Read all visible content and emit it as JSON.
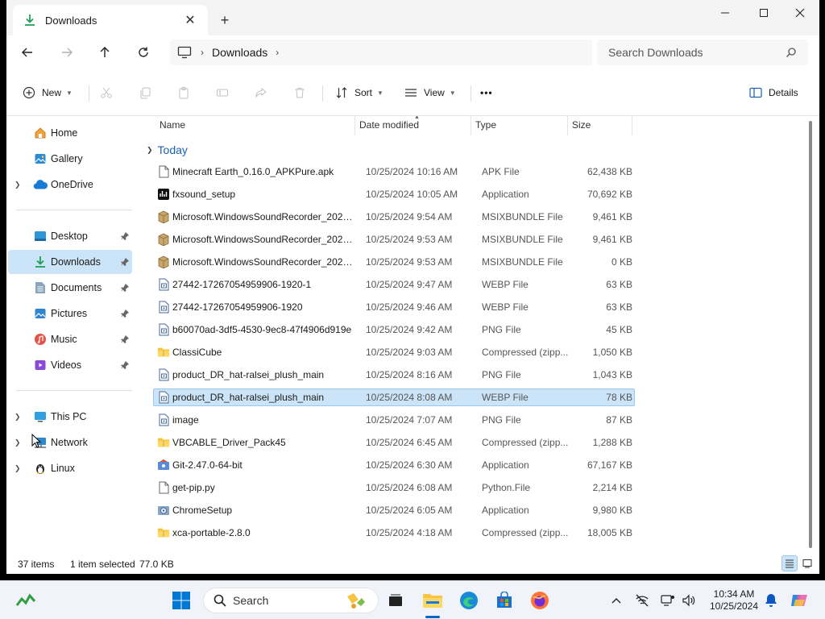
{
  "window": {
    "tab_title": "Downloads",
    "new_tab_symbol": "+",
    "close_symbol": "✕"
  },
  "address": {
    "crumbs": [
      "Downloads"
    ],
    "search_placeholder": "Search Downloads"
  },
  "commandbar": {
    "new_label": "New",
    "sort_label": "Sort",
    "view_label": "View",
    "more_label": "•••",
    "details_label": "Details"
  },
  "sidebar": {
    "items": [
      {
        "label": "Home",
        "icon": "home-icon"
      },
      {
        "label": "Gallery",
        "icon": "gallery-icon"
      },
      {
        "label": "OneDrive",
        "icon": "cloud-icon"
      },
      {
        "label": "Desktop",
        "icon": "desktop-icon"
      },
      {
        "label": "Downloads",
        "icon": "download-icon"
      },
      {
        "label": "Documents",
        "icon": "documents-icon"
      },
      {
        "label": "Pictures",
        "icon": "pictures-icon"
      },
      {
        "label": "Music",
        "icon": "music-icon"
      },
      {
        "label": "Videos",
        "icon": "videos-icon"
      },
      {
        "label": "This PC",
        "icon": "pc-icon"
      },
      {
        "label": "Network",
        "icon": "network-icon"
      },
      {
        "label": "Linux",
        "icon": "linux-icon"
      }
    ]
  },
  "filelist": {
    "columns": [
      "Name",
      "Date modified",
      "Type",
      "Size"
    ],
    "group_label": "Today",
    "rows": [
      {
        "name": "Minecraft Earth_0.16.0_APKPure.apk",
        "date": "10/25/2024 10:16 AM",
        "type": "APK File",
        "size": "62,438 KB",
        "icon": "file"
      },
      {
        "name": "fxsound_setup",
        "date": "10/25/2024 10:05 AM",
        "type": "Application",
        "size": "70,692 KB",
        "icon": "fx"
      },
      {
        "name": "Microsoft.WindowsSoundRecorder_2021....",
        "date": "10/25/2024 9:54 AM",
        "type": "MSIXBUNDLE File",
        "size": "9,461 KB",
        "icon": "package"
      },
      {
        "name": "Microsoft.WindowsSoundRecorder_2021....",
        "date": "10/25/2024 9:53 AM",
        "type": "MSIXBUNDLE File",
        "size": "9,461 KB",
        "icon": "package"
      },
      {
        "name": "Microsoft.WindowsSoundRecorder_2021....",
        "date": "10/25/2024 9:53 AM",
        "type": "MSIXBUNDLE File",
        "size": "0 KB",
        "icon": "package"
      },
      {
        "name": "27442-17267054959906-1920-1",
        "date": "10/25/2024 9:47 AM",
        "type": "WEBP File",
        "size": "63 KB",
        "icon": "image"
      },
      {
        "name": "27442-17267054959906-1920",
        "date": "10/25/2024 9:46 AM",
        "type": "WEBP File",
        "size": "63 KB",
        "icon": "image"
      },
      {
        "name": "b60070ad-3df5-4530-9ec8-47f4906d919e",
        "date": "10/25/2024 9:42 AM",
        "type": "PNG File",
        "size": "45 KB",
        "icon": "image"
      },
      {
        "name": "ClassiCube",
        "date": "10/25/2024 9:03 AM",
        "type": "Compressed (zipp...",
        "size": "1,050 KB",
        "icon": "zip"
      },
      {
        "name": "product_DR_hat-ralsei_plush_main",
        "date": "10/25/2024 8:16 AM",
        "type": "PNG File",
        "size": "1,043 KB",
        "icon": "image"
      },
      {
        "name": "product_DR_hat-ralsei_plush_main",
        "date": "10/25/2024 8:08 AM",
        "type": "WEBP File",
        "size": "78 KB",
        "icon": "image"
      },
      {
        "name": "image",
        "date": "10/25/2024 7:07 AM",
        "type": "PNG File",
        "size": "87 KB",
        "icon": "image"
      },
      {
        "name": "VBCABLE_Driver_Pack45",
        "date": "10/25/2024 6:45 AM",
        "type": "Compressed (zipp...",
        "size": "1,288 KB",
        "icon": "zip"
      },
      {
        "name": "Git-2.47.0-64-bit",
        "date": "10/25/2024 6:30 AM",
        "type": "Application",
        "size": "67,167 KB",
        "icon": "git"
      },
      {
        "name": "get-pip.py",
        "date": "10/25/2024 6:08 AM",
        "type": "Python.File",
        "size": "2,214 KB",
        "icon": "file"
      },
      {
        "name": "ChromeSetup",
        "date": "10/25/2024 6:05 AM",
        "type": "Application",
        "size": "9,980 KB",
        "icon": "setup"
      },
      {
        "name": "xca-portable-2.8.0",
        "date": "10/25/2024 4:18 AM",
        "type": "Compressed (zipp...",
        "size": "18,005 KB",
        "icon": "zip"
      }
    ],
    "selected_index": 10
  },
  "status": {
    "item_count": "37 items",
    "selection": "1 item selected",
    "selection_size": "77.0 KB"
  },
  "taskbar": {
    "search_label": "Search",
    "time": "10:34 AM",
    "date": "10/25/2024"
  },
  "colors": {
    "accent": "#0067c0",
    "selection": "#cce4f7",
    "folder": "#f8c542"
  }
}
